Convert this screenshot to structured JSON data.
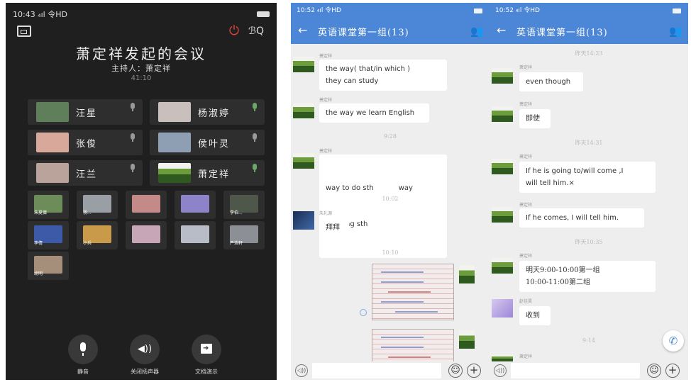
{
  "meeting": {
    "status": {
      "time": "10:43",
      "signal": "₄ıl",
      "wifi": "令HD"
    },
    "title": "萧定祥发起的会议",
    "host": "主持人：萧定祥",
    "timer": "41:10",
    "participants": [
      {
        "name": "汪星",
        "avatar": "#5f7f5a",
        "mic_color": "#999999"
      },
      {
        "name": "杨淑婷",
        "avatar": "#c9c0bd",
        "mic_color": "#6da66b"
      },
      {
        "name": "张俊",
        "avatar": "#d8a89a",
        "mic_color": "#999999"
      },
      {
        "name": "侯叶灵",
        "avatar": "#8e9fb4",
        "mic_color": "#999999"
      },
      {
        "name": "汪兰",
        "avatar": "#b9a39a",
        "mic_color": "#999999"
      },
      {
        "name": "萧定祥",
        "avatar": "#6c9c3b",
        "mic_color": "#6da66b"
      }
    ],
    "small_tiles": [
      {
        "label": "朱夏傑",
        "color": "#6c8c5a"
      },
      {
        "label": "杨...",
        "color": "#9a9fa6"
      },
      {
        "label": "",
        "color": "#c48a88"
      },
      {
        "label": "",
        "color": "#8c83c9"
      },
      {
        "label": "李伯...",
        "color": "#4f574a"
      },
      {
        "label": "李倩",
        "color": "#3d5aa8"
      },
      {
        "label": "小兵",
        "color": "#c99a4a"
      },
      {
        "label": "",
        "color": "#c7a7b7"
      },
      {
        "label": "",
        "color": "#b8bcc6"
      },
      {
        "label": "严浩轩",
        "color": "#8c8f95"
      },
      {
        "label": "胡明",
        "color": "#a68f7a"
      }
    ],
    "controls": {
      "mute": "静音",
      "speaker": "关闭扬声器",
      "share": "文档演示"
    }
  },
  "chat1": {
    "status": "10:52 ₄ıl 令HD",
    "title": "英语课堂第一组(13)",
    "messages": [
      {
        "nick": "萧定祥",
        "text1": "the way( that/in which )",
        "text2": "they can study"
      },
      {
        "nick": "萧定祥",
        "text1": "the way we learn English"
      },
      {
        "time": "9:28"
      },
      {
        "nick": "萧定祥",
        "text1": "way to do sth           way",
        "text2": "of doing sth"
      },
      {
        "time": "10:02"
      },
      {
        "nick": "朱礼源",
        "text1": "拜拜"
      },
      {
        "time": "10:10"
      }
    ]
  },
  "chat2": {
    "status": "10:52 ₄ıl 令HD",
    "title": "英语课堂第一组(13)",
    "messages": [
      {
        "time": "昨天14:23"
      },
      {
        "nick": "萧定祥",
        "text1": "even though"
      },
      {
        "nick": "萧定祥",
        "text1": "即使"
      },
      {
        "time": "昨天14:31"
      },
      {
        "nick": "萧定祥",
        "text1": "If he is going to/will come ,I",
        "text2": "will tell him.×"
      },
      {
        "nick": "萧定祥",
        "text1": "If he comes, I will tell him."
      },
      {
        "time": "昨天10:35"
      },
      {
        "nick": "萧定祥",
        "text1": "明天9:00-10:00第一组",
        "text2": "10:00-11:00第二组"
      },
      {
        "nick": "赵佳昊",
        "text1": "收到"
      },
      {
        "time": "9:14"
      },
      {
        "nick": "萧定祥"
      }
    ]
  },
  "icons": {
    "back": "←",
    "group": "👥",
    "power": "⏻",
    "voice": "◁))",
    "emoji": "☺",
    "plus": "+",
    "phone": "✆",
    "speaker": "◀))"
  },
  "colors": {
    "accent": "#4c86d6",
    "meeting_bg": "#1f1f1f",
    "power": "#e0473b"
  }
}
